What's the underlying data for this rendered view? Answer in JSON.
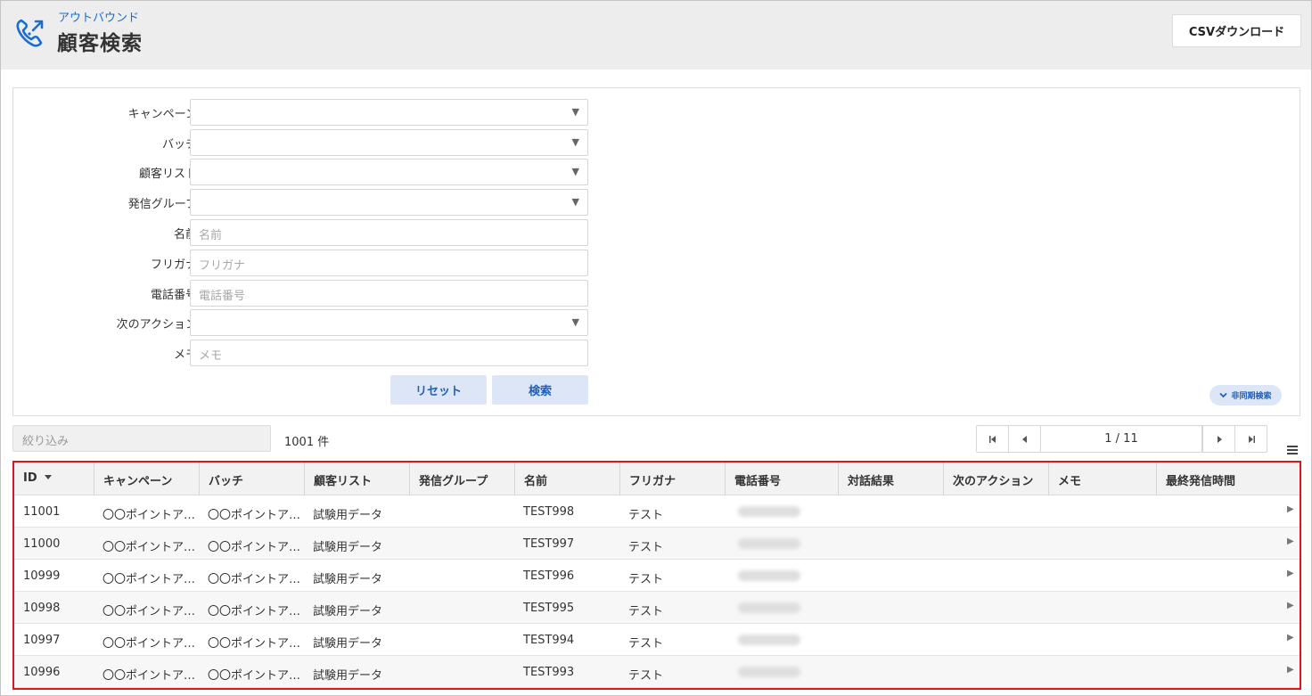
{
  "header": {
    "subtitle": "アウトバウンド",
    "title": "顧客検索",
    "csv_button": "CSVダウンロード",
    "accent_color": "#1a6dd1",
    "icon": "phone-outbound-icon"
  },
  "search_form": {
    "fields": [
      {
        "label": "キャンペーン",
        "type": "select",
        "value": "",
        "placeholder": ""
      },
      {
        "label": "バッチ",
        "type": "select",
        "value": "",
        "placeholder": ""
      },
      {
        "label": "顧客リスト",
        "type": "select",
        "value": "",
        "placeholder": ""
      },
      {
        "label": "発信グループ",
        "type": "select",
        "value": "",
        "placeholder": ""
      },
      {
        "label": "名前",
        "type": "text",
        "value": "",
        "placeholder": "名前"
      },
      {
        "label": "フリガナ",
        "type": "text",
        "value": "",
        "placeholder": "フリガナ"
      },
      {
        "label": "電話番号",
        "type": "text",
        "value": "",
        "placeholder": "電話番号"
      },
      {
        "label": "次のアクション",
        "type": "select",
        "value": "",
        "placeholder": ""
      },
      {
        "label": "メモ",
        "type": "text",
        "value": "",
        "placeholder": "メモ"
      }
    ],
    "reset_button": "リセット",
    "search_button": "検索",
    "async_search": "非同期検索"
  },
  "results": {
    "filter_placeholder": "絞り込み",
    "count_text": "1001 件",
    "pager": {
      "label": "1 / 11"
    }
  },
  "table": {
    "columns": [
      "ID",
      "キャンペーン",
      "バッチ",
      "顧客リスト",
      "発信グループ",
      "名前",
      "フリガナ",
      "電話番号",
      "対話結果",
      "次のアクション",
      "メモ",
      "最終発信時間"
    ],
    "rows": [
      {
        "id": "11001",
        "campaign": "〇〇ポイントア…",
        "batch": "〇〇ポイントア…",
        "list": "試験用データ",
        "group": "",
        "name": "TEST998",
        "kana": "テスト",
        "phone": "",
        "result": "",
        "next_action": "",
        "memo": "",
        "last_call": ""
      },
      {
        "id": "11000",
        "campaign": "〇〇ポイントア…",
        "batch": "〇〇ポイントア…",
        "list": "試験用データ",
        "group": "",
        "name": "TEST997",
        "kana": "テスト",
        "phone": "",
        "result": "",
        "next_action": "",
        "memo": "",
        "last_call": ""
      },
      {
        "id": "10999",
        "campaign": "〇〇ポイントア…",
        "batch": "〇〇ポイントア…",
        "list": "試験用データ",
        "group": "",
        "name": "TEST996",
        "kana": "テスト",
        "phone": "",
        "result": "",
        "next_action": "",
        "memo": "",
        "last_call": ""
      },
      {
        "id": "10998",
        "campaign": "〇〇ポイントア…",
        "batch": "〇〇ポイントア…",
        "list": "試験用データ",
        "group": "",
        "name": "TEST995",
        "kana": "テスト",
        "phone": "",
        "result": "",
        "next_action": "",
        "memo": "",
        "last_call": ""
      },
      {
        "id": "10997",
        "campaign": "〇〇ポイントア…",
        "batch": "〇〇ポイントア…",
        "list": "試験用データ",
        "group": "",
        "name": "TEST994",
        "kana": "テスト",
        "phone": "",
        "result": "",
        "next_action": "",
        "memo": "",
        "last_call": ""
      },
      {
        "id": "10996",
        "campaign": "〇〇ポイントア…",
        "batch": "〇〇ポイントア…",
        "list": "試験用データ",
        "group": "",
        "name": "TEST993",
        "kana": "テスト",
        "phone": "",
        "result": "",
        "next_action": "",
        "memo": "",
        "last_call": ""
      }
    ]
  },
  "colors": {
    "highlight_border": "#d9171f",
    "button_bg": "#dde6f7",
    "button_text": "#1f5fbf"
  }
}
